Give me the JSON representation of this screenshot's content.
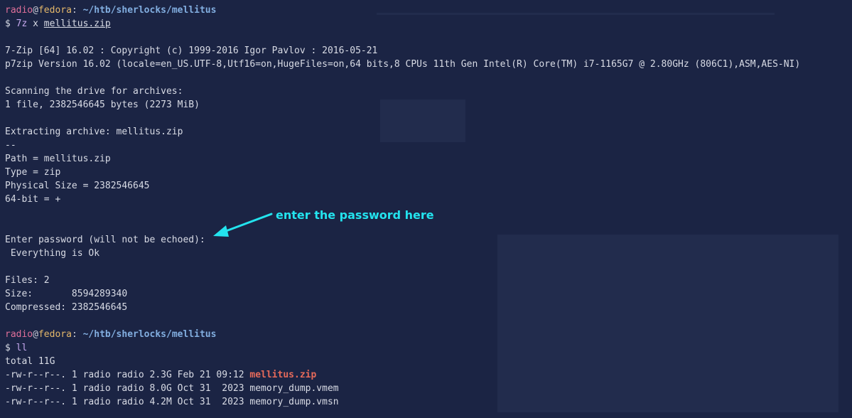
{
  "prompt1": {
    "user": "radio",
    "at": "@",
    "host": "fedora",
    "colon": ":",
    "cwd": " ~/htb/sherlocks/mellitus",
    "dollar": "$ ",
    "cmd": "7z",
    "sub": " x ",
    "file": "mellitus.zip"
  },
  "output": {
    "line1": "7-Zip [64] 16.02 : Copyright (c) 1999-2016 Igor Pavlov : 2016-05-21",
    "line2": "p7zip Version 16.02 (locale=en_US.UTF-8,Utf16=on,HugeFiles=on,64 bits,8 CPUs 11th Gen Intel(R) Core(TM) i7-1165G7 @ 2.80GHz (806C1),ASM,AES-NI)",
    "line3": "Scanning the drive for archives:",
    "line4": "1 file, 2382546645 bytes (2273 MiB)",
    "line5": "Extracting archive: mellitus.zip",
    "line6": "--",
    "line7": "Path = mellitus.zip",
    "line8": "Type = zip",
    "line9": "Physical Size = 2382546645",
    "line10": "64-bit = +",
    "line11": "Enter password (will not be echoed):",
    "line12": " Everything is Ok",
    "line13": "Files: 2",
    "line14": "Size:       8594289340",
    "line15": "Compressed: 2382546645"
  },
  "prompt2": {
    "user": "radio",
    "at": "@",
    "host": "fedora",
    "colon": ":",
    "cwd": " ~/htb/sherlocks/mellitus",
    "dollar": "$ ",
    "cmd": "ll"
  },
  "listing": {
    "total": "total 11G",
    "rows": [
      {
        "prefix": "-rw-r--r--. 1 radio radio 2.3G Feb 21 09:12 ",
        "name": "mellitus.zip"
      },
      {
        "prefix": "-rw-r--r--. 1 radio radio 8.0G Oct 31  2023 ",
        "name": "memory_dump.vmem"
      },
      {
        "prefix": "-rw-r--r--. 1 radio radio 4.2M Oct 31  2023 ",
        "name": "memory_dump.vmsn"
      }
    ]
  },
  "annotation": {
    "text": "enter the password here",
    "color": "#23e3ee"
  }
}
